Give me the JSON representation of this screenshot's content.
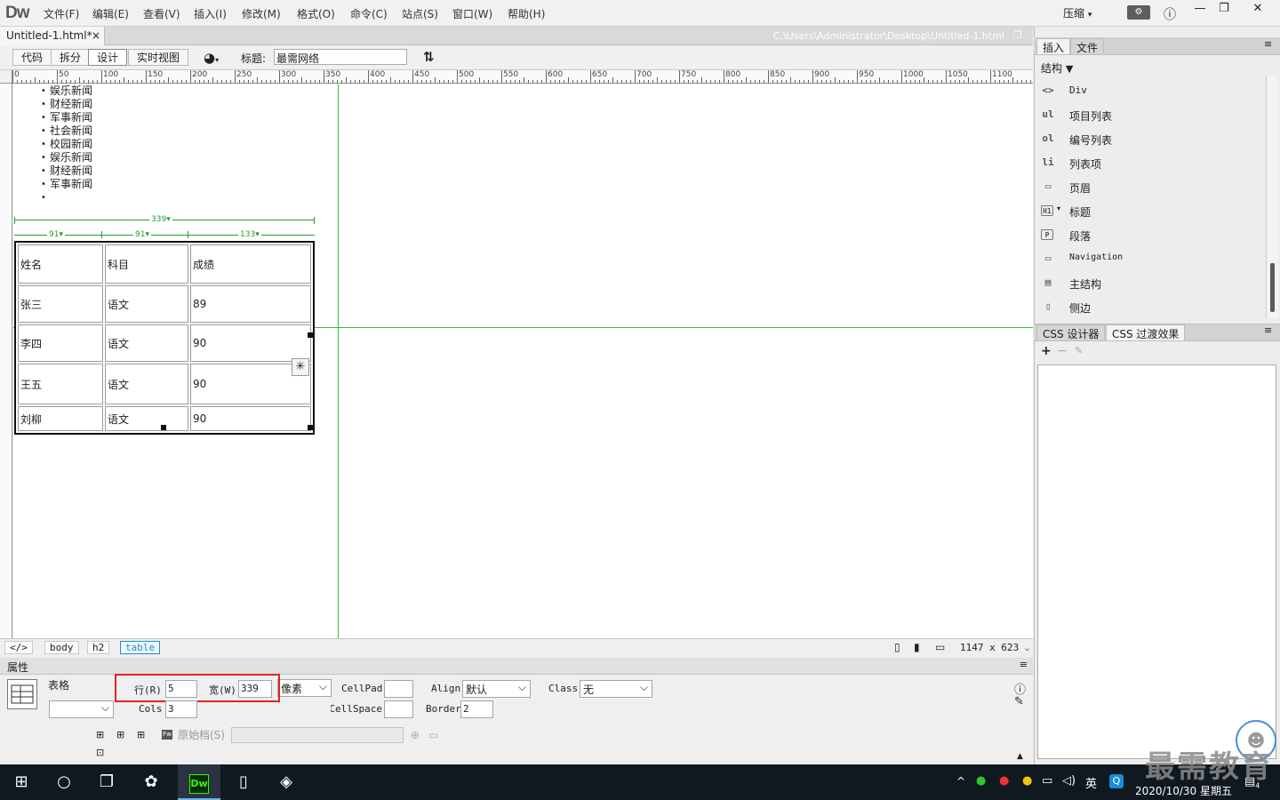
{
  "app": {
    "logo": "Dw",
    "compress_label": "压缩"
  },
  "menu": [
    "文件(F)",
    "编辑(E)",
    "查看(V)",
    "插入(I)",
    "修改(M)",
    "格式(O)",
    "命令(C)",
    "站点(S)",
    "窗口(W)",
    "帮助(H)"
  ],
  "doc": {
    "tab_label": "Untitled-1.html*",
    "close": "×",
    "path": "C:\\Users\\Administrator\\Desktop\\Untitled-1.html"
  },
  "toolbar": {
    "code": "代码",
    "split": "拆分",
    "design": "设计",
    "live": "实时视图",
    "title_label": "标题:",
    "title_value": "最需网络"
  },
  "ruler": [
    "0",
    "50",
    "100",
    "150",
    "200",
    "250",
    "300",
    "350",
    "400",
    "450",
    "500",
    "550",
    "600",
    "650",
    "700",
    "750",
    "800",
    "850",
    "900",
    "950",
    "1000",
    "1050",
    "1100"
  ],
  "news": [
    "娱乐新闻",
    "财经新闻",
    "军事新闻",
    "社会新闻",
    "校园新闻",
    "娱乐新闻",
    "财经新闻",
    "军事新闻",
    ""
  ],
  "table_widths": {
    "total": "339",
    "c1": "91",
    "c2": "91",
    "c3": "133"
  },
  "table": [
    [
      "姓名",
      "科目",
      "成绩"
    ],
    [
      "张三",
      "语文",
      "89"
    ],
    [
      "李四",
      "语文",
      "90"
    ],
    [
      "王五",
      "语文",
      "90"
    ],
    [
      "刘柳",
      "语文",
      "90"
    ]
  ],
  "tags": {
    "root": "</>",
    "body": "body",
    "h2": "h2",
    "table": "table",
    "size": "1147 x 623"
  },
  "props": {
    "header": "属性",
    "element": "表格",
    "rows_label": "行(R)",
    "rows": "5",
    "width_label": "宽(W)",
    "width": "339",
    "unit": "像素",
    "cols_label": "Cols",
    "cols": "3",
    "cellpad_label": "CellPad",
    "cellpad": "",
    "cellspace_label": "CellSpace",
    "cellspace": "",
    "align_label": "Align",
    "align": "默认",
    "border_label": "Border",
    "border": "2",
    "class_label": "Class",
    "class": "无",
    "src_label": "原始档(S)"
  },
  "right": {
    "tab_insert": "插入",
    "tab_files": "文件",
    "category": "结构",
    "items": [
      {
        "icon": "<>",
        "label": "Div"
      },
      {
        "icon": "ul",
        "label": "项目列表"
      },
      {
        "icon": "ol",
        "label": "编号列表"
      },
      {
        "icon": "li",
        "label": "列表项"
      },
      {
        "icon": "▭",
        "label": "页眉"
      },
      {
        "icon": "H1",
        "label": "标题"
      },
      {
        "icon": "P",
        "label": "段落"
      },
      {
        "icon": "▭",
        "label": "Navigation"
      },
      {
        "icon": "▤",
        "label": "主结构"
      },
      {
        "icon": "▯",
        "label": "侧边"
      }
    ],
    "css_tab1": "CSS 设计器",
    "css_tab2": "CSS 过渡效果"
  },
  "taskbar": {
    "time": "",
    "date": "2020/10/30 星期五",
    "lang": "英",
    "notify": "4"
  },
  "watermark": "最需教育"
}
